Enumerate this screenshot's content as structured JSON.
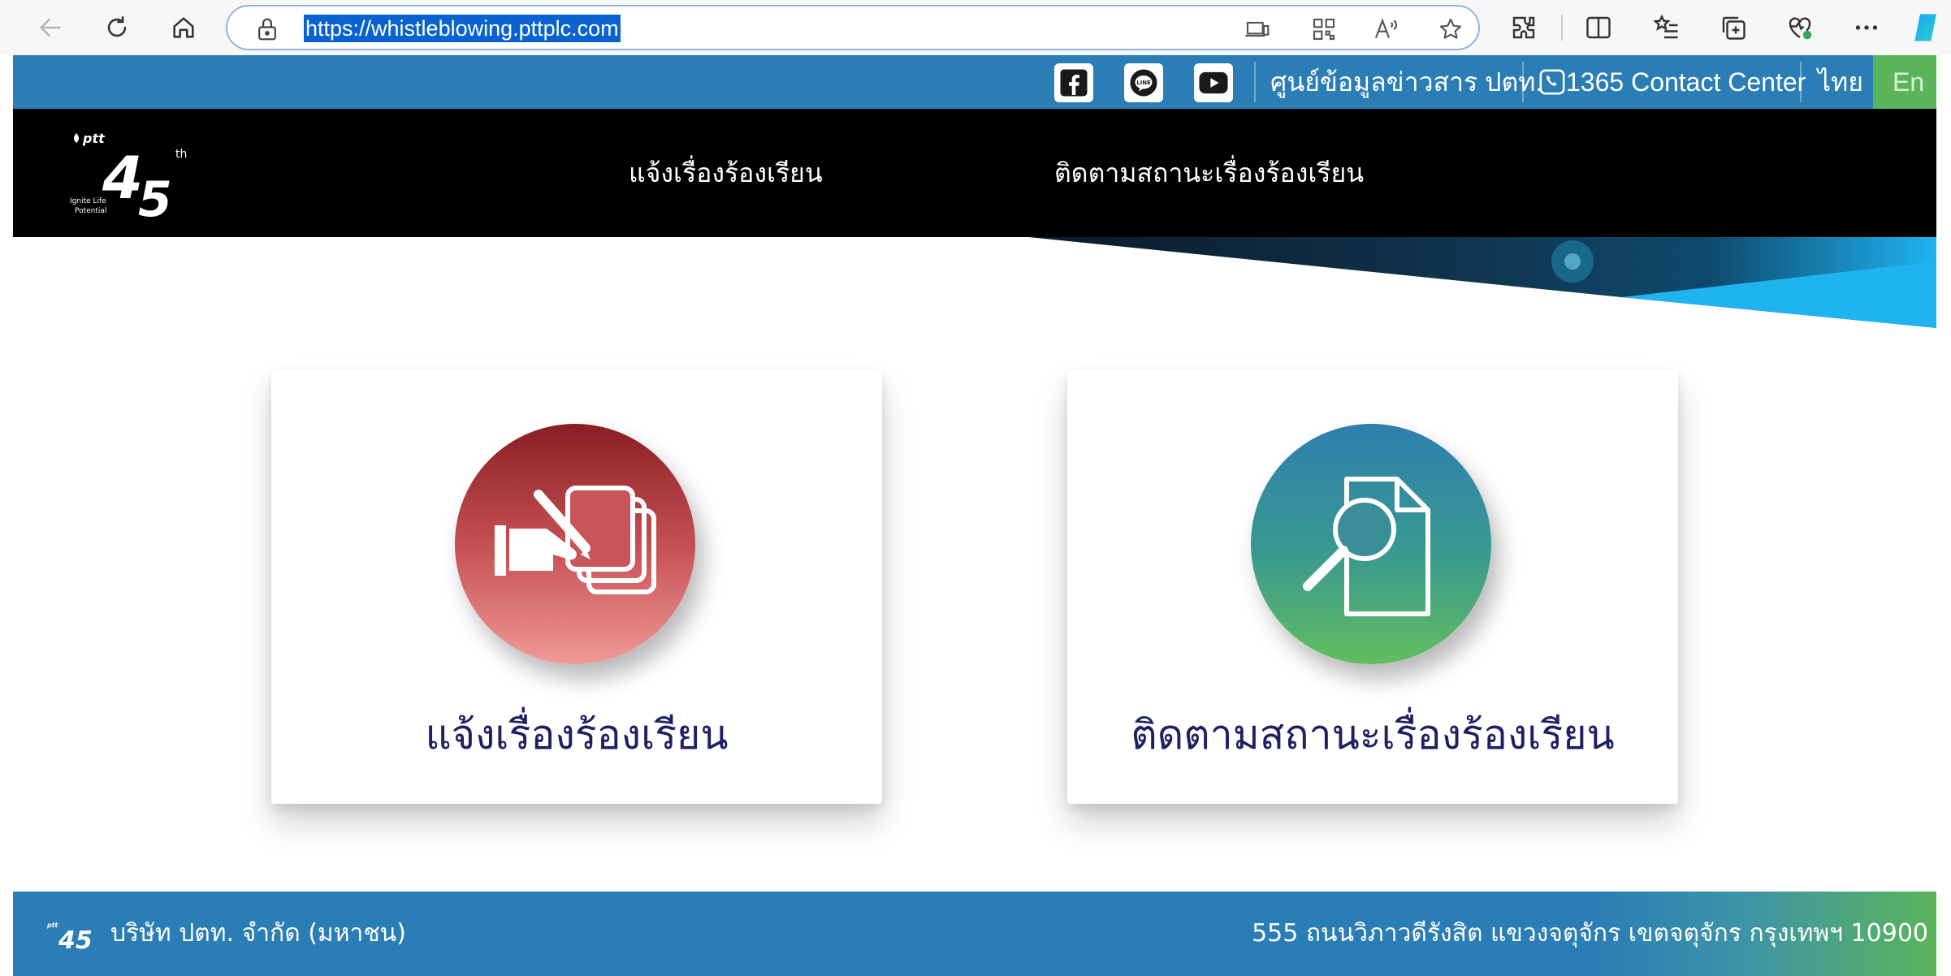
{
  "browser": {
    "url": "https://whistleblowing.pttplc.com",
    "icons": [
      "back-icon",
      "refresh-icon",
      "home-icon",
      "lock-icon",
      "app-available-icon",
      "qr-icon",
      "read-aloud-icon",
      "favorite-star-icon",
      "extensions-icon",
      "split-screen-icon",
      "favorites-list-icon",
      "collections-icon",
      "browser-essentials-icon",
      "more-options-icon",
      "copilot-icon"
    ]
  },
  "topbar": {
    "info_center": "ศูนย์ข้อมูลข่าวสาร ปตท.",
    "contact": "1365 Contact Center",
    "lang_th": "ไทย",
    "lang_en": "En",
    "social": [
      "facebook-icon",
      "line-icon",
      "youtube-icon"
    ]
  },
  "nav": {
    "logo_text": "ptt 45th Ignite Life Potential",
    "report": "แจ้งเรื่องร้องเรียน",
    "track": "ติดตามสถานะเรื่องร้องเรียน"
  },
  "cards": [
    {
      "label": "แจ้งเรื่องร้องเรียน",
      "icon": "hand-writing-documents-icon"
    },
    {
      "label": "ติดตามสถานะเรื่องร้องเรียน",
      "icon": "document-search-icon"
    }
  ],
  "footer": {
    "company": "บริษัท ปตท. จำกัด (มหาชน)",
    "address": "555 ถนนวิภาวดีรังสิต แขวงจตุจักร เขตจตุจักร กรุงเทพฯ 10900"
  },
  "colors": {
    "topbar": "#2a7db5",
    "nav_band": "#000000",
    "card_text": "#1f1f63",
    "report_gradient": [
      "#8a1e22",
      "#f09a96"
    ],
    "track_gradient": [
      "#2e7fae",
      "#62bd5e"
    ],
    "accent_green": "#5ab55a",
    "banner_blue": "#1fb3f0"
  }
}
